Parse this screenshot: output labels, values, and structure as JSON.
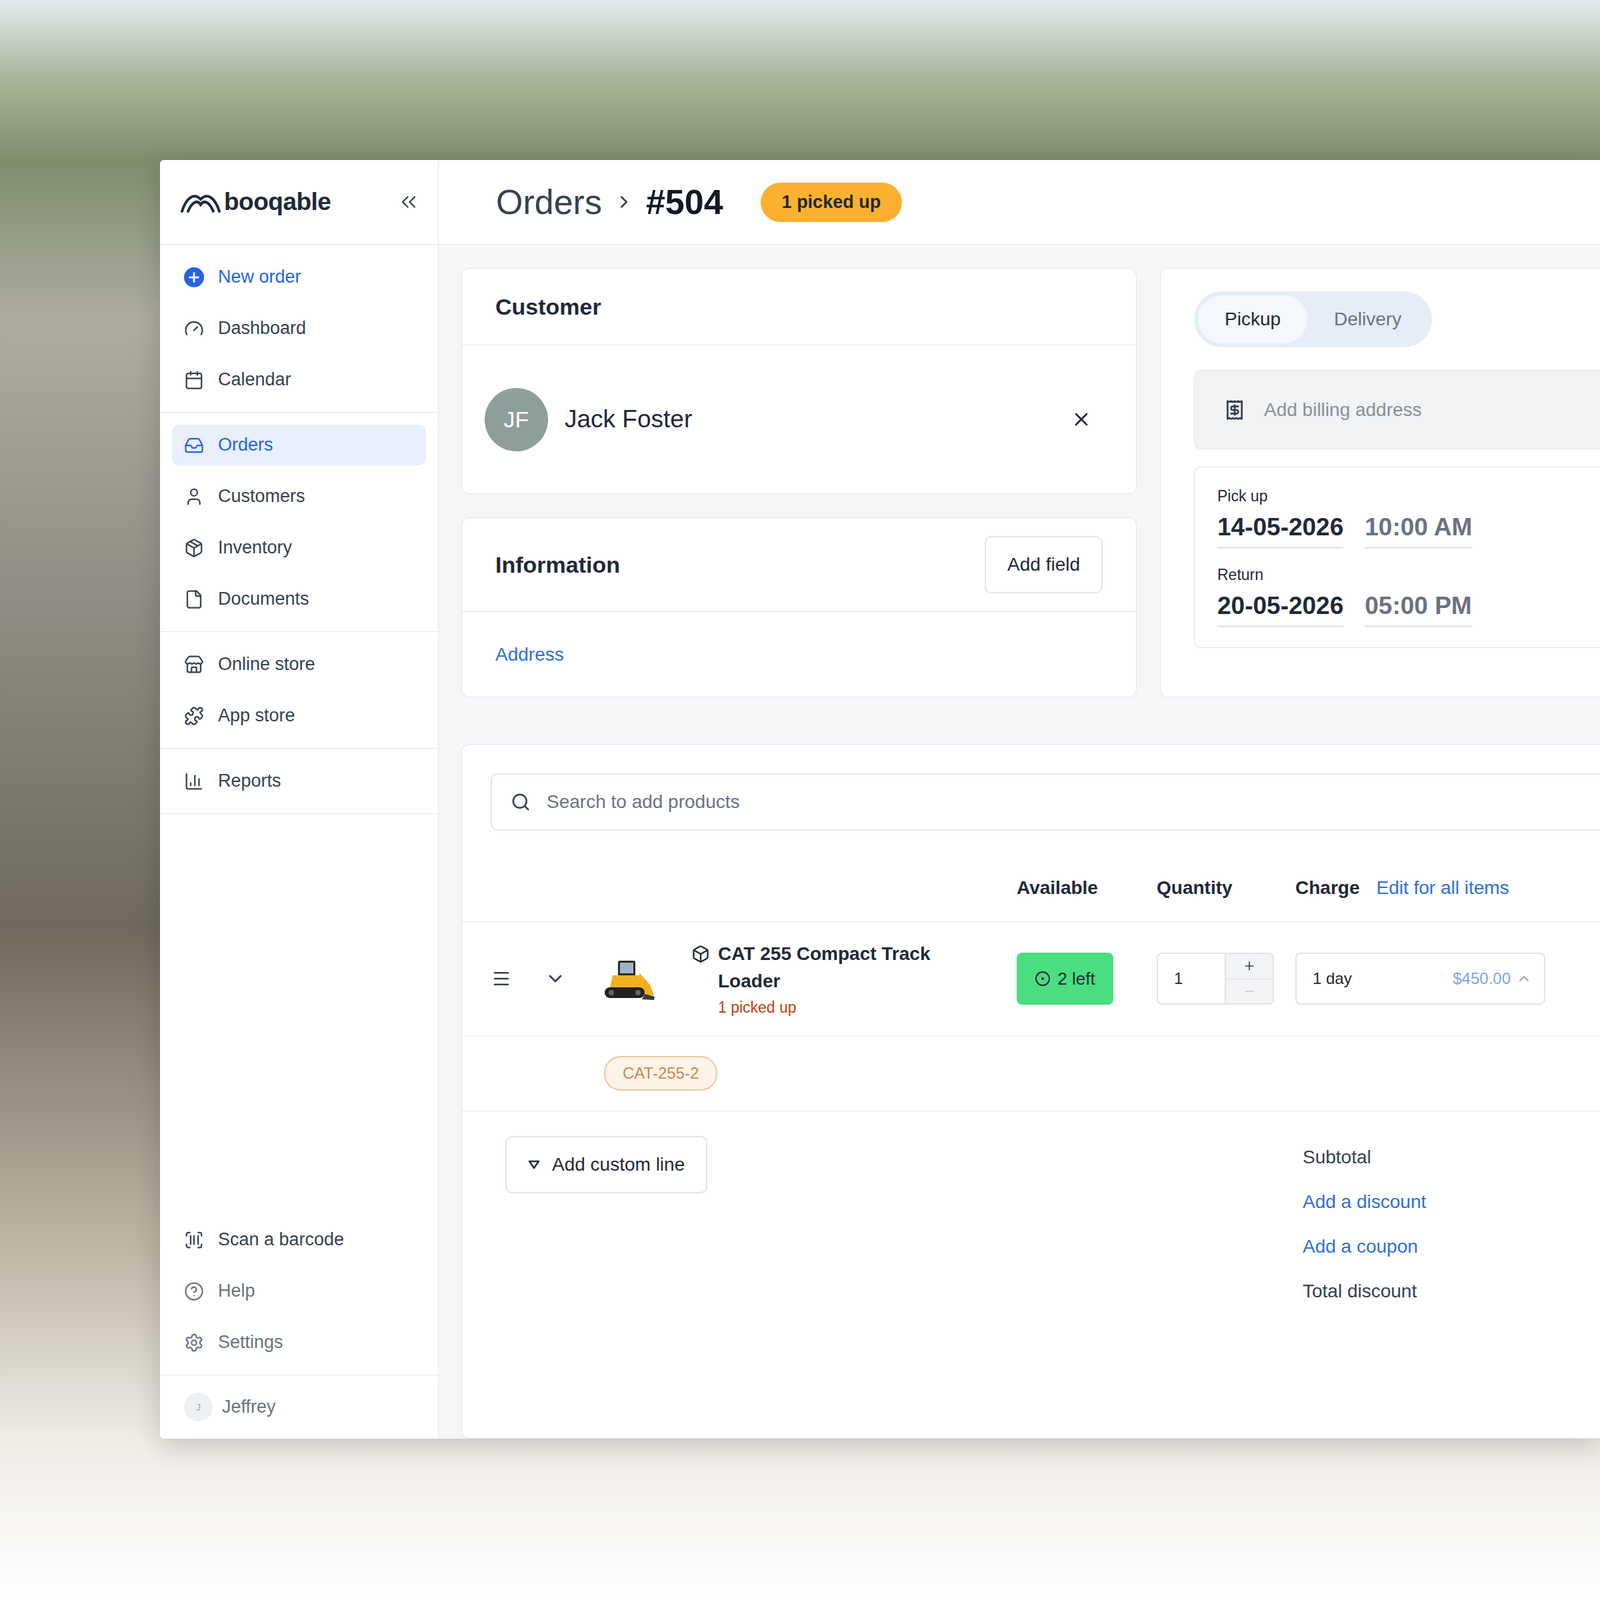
{
  "logo": {
    "text": "booqable"
  },
  "sidebar": {
    "groups": [
      [
        {
          "label": "New order",
          "kind": "action",
          "selected": false
        },
        {
          "label": "Dashboard",
          "kind": "link",
          "selected": false
        },
        {
          "label": "Calendar",
          "kind": "link",
          "selected": false
        }
      ],
      [
        {
          "label": "Orders",
          "kind": "link",
          "selected": true
        },
        {
          "label": "Customers",
          "kind": "link",
          "selected": false
        },
        {
          "label": "Inventory",
          "kind": "link",
          "selected": false
        },
        {
          "label": "Documents",
          "kind": "link",
          "selected": false
        }
      ],
      [
        {
          "label": "Online store",
          "kind": "link",
          "selected": false
        },
        {
          "label": "App store",
          "kind": "link",
          "selected": false
        }
      ],
      [
        {
          "label": "Reports",
          "kind": "link",
          "selected": false
        }
      ]
    ],
    "footer": [
      {
        "label": "Scan a barcode",
        "muted": false
      },
      {
        "label": "Help",
        "muted": true
      },
      {
        "label": "Settings",
        "muted": true
      }
    ],
    "user": {
      "initial": "J",
      "name": "Jeffrey"
    }
  },
  "header": {
    "breadcrumb": "Orders",
    "order_number": "#504",
    "status_badge": "1 picked up"
  },
  "customer": {
    "title": "Customer",
    "initials": "JF",
    "name": "Jack Foster"
  },
  "information": {
    "title": "Information",
    "add_button": "Add field",
    "links": [
      "Address"
    ]
  },
  "fulfillment": {
    "tabs": [
      {
        "label": "Pickup",
        "selected": true
      },
      {
        "label": "Delivery",
        "selected": false
      }
    ],
    "billing_placeholder": "Add billing address",
    "dates": [
      {
        "label": "Pick up",
        "date": "14-05-2026",
        "time": "10:00 AM"
      },
      {
        "label": "Return",
        "date": "20-05-2026",
        "time": "05:00 PM"
      }
    ]
  },
  "products": {
    "search_placeholder": "Search to add products",
    "columns": [
      "Available",
      "Quantity",
      "Charge"
    ],
    "edit_all": "Edit for all items",
    "rows": [
      {
        "name": "CAT 255 Compact Track Loader",
        "status": "1 picked up",
        "available": "2 left",
        "quantity": "1",
        "charge_period": "1 day",
        "charge_amount": "$450.00",
        "expanded": false,
        "tags": [
          "CAT-255-2"
        ]
      }
    ],
    "add_custom_line": "Add custom line",
    "totals": [
      {
        "label": "Subtotal",
        "kind": "text"
      },
      {
        "label": "Add a discount",
        "kind": "link"
      },
      {
        "label": "Add a coupon",
        "kind": "link"
      },
      {
        "label": "Total discount",
        "kind": "text"
      }
    ]
  }
}
